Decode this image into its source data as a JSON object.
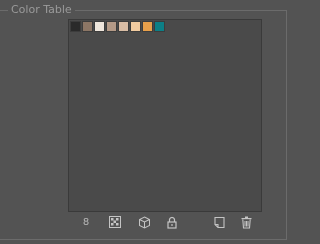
{
  "panel": {
    "title": "Color Table"
  },
  "color_table": {
    "swatches": [
      {
        "color": "#2a2a2a"
      },
      {
        "color": "#8c7665"
      },
      {
        "color": "#efe6dc"
      },
      {
        "color": "#b49a87"
      },
      {
        "color": "#d9bda5"
      },
      {
        "color": "#f1cba0"
      },
      {
        "color": "#e8a04b"
      },
      {
        "color": "#0d7f86"
      }
    ]
  },
  "toolbar": {
    "color_count": "8",
    "icons": {
      "transparency": "checkerboard-icon",
      "web_shift": "cube-icon",
      "lock": "lock-icon",
      "new_color": "new-swatch-icon",
      "delete": "trash-icon"
    }
  }
}
